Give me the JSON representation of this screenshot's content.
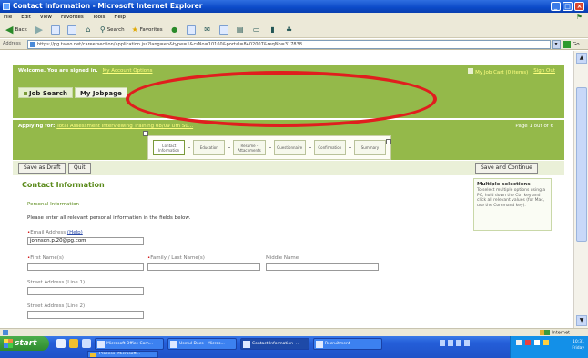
{
  "window": {
    "title": "Contact Information - Microsoft Internet Explorer",
    "controls": [
      "_",
      "□",
      "×"
    ]
  },
  "menu": [
    "File",
    "Edit",
    "View",
    "Favorites",
    "Tools",
    "Help"
  ],
  "toolbar": {
    "back_label": "Back",
    "search_label": "Search",
    "favorites_label": "Favorites"
  },
  "address": {
    "label": "Address",
    "url": "https://pg.taleo.net/careersection/application.jss?lang=en&type=1&csNo=10160&portal=8402007&reqNo=317838",
    "go_label": "Go"
  },
  "header": {
    "welcome": "Welcome. You are signed in.",
    "account_link": "My Account Options",
    "cart_link": "My Job Cart (0 items)",
    "signout_link": "Sign Out"
  },
  "tabs": [
    "Job Search",
    "My Jobpage"
  ],
  "applying": {
    "prefix": "Applying for:",
    "job_link": "Total Assessment Interviewing Training 08/09 Urn Su...",
    "page_info": "Page 1 out of 6"
  },
  "steps": [
    "Contact Information",
    "Education",
    "Resume - Attachments",
    "Questionnaire",
    "Confirmation",
    "Summary"
  ],
  "actions": {
    "save_draft": "Save as Draft",
    "quit": "Quit",
    "save_continue": "Save and Continue"
  },
  "content": {
    "title": "Contact Information",
    "section": "Personal Information",
    "instructions": "Please enter all relevant personal information in the fields below."
  },
  "sidebox": {
    "title": "Multiple selections",
    "body": "To select multiple options using a PC, hold down the Ctrl key and click all relevant values (for Mac, use the Command key)."
  },
  "fields": {
    "email_label": "Email Address",
    "email_help": "(Help)",
    "email_value": "johnson.p.20@pg.com",
    "first_name_label": "First Name(s)",
    "last_name_label": "Family / Last Name(s)",
    "middle_name_label": "Middle Name",
    "street1_label": "Street Address (Line 1)",
    "street2_label": "Street Address (Line 2)"
  },
  "status": {
    "zone": "Internet"
  },
  "taskbar": {
    "start": "start",
    "tasks": [
      "Microsoft Office Com...",
      "Useful Docs - Micros...",
      "Contact Information -...",
      "Recruitment"
    ],
    "task_row2": "Process (Microsoft...",
    "clock_time": "10:31",
    "clock_day": "Friday"
  },
  "colors": {
    "header_green": "#94b94a",
    "title_green": "#5a8a1a",
    "annotation_red": "#e01e1e",
    "xp_blue": "#245ed8"
  }
}
